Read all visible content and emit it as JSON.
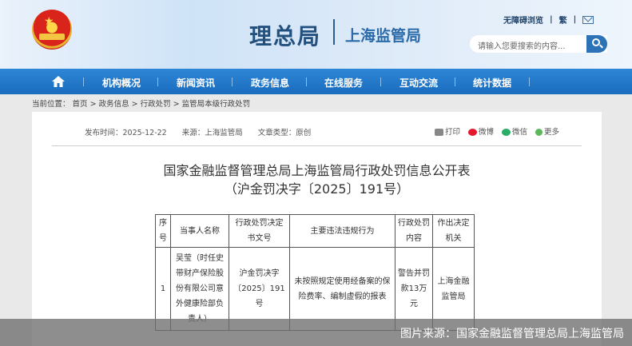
{
  "header": {
    "title": "理总局",
    "subtitle": "上海监管局",
    "accessibility": "无障碍浏览",
    "traditional": "繁",
    "search_placeholder": "请输入您要搜索的内容..."
  },
  "nav": {
    "items": [
      "机构概况",
      "新闻资讯",
      "政务信息",
      "在线服务",
      "互动交流",
      "统计数据"
    ]
  },
  "breadcrumb": {
    "prefix": "当前位置：",
    "items": [
      "首页",
      "政务信息",
      "行政处罚",
      "监管局本级行政处罚"
    ]
  },
  "article": {
    "publish_date": "发布时间：2025-12-22",
    "source": "来源：上海监管局",
    "doc_type": "文章类型：原创",
    "share": [
      "打印",
      "微博",
      "微信",
      "更多"
    ],
    "title_line1": "国家金融监督管理总局上海监管局行政处罚信息公开表",
    "title_line2": "（沪金罚决字〔2025〕191号）"
  },
  "table": {
    "headers": [
      "序号",
      "当事人名称",
      "行政处罚决定书文号",
      "主要违法违规行为",
      "行政处罚内容",
      "作出决定机关"
    ],
    "row": {
      "index": "1",
      "party": "吴莹（时任史带财产保险股份有限公司意外健康险部负责人）",
      "doc_number": "沪金罚决字〔2025〕191号",
      "violation": "未按照规定使用经备案的保险费率、编制虚假的报表",
      "penalty": "警告并罚款13万元",
      "authority": "上海金融监管局"
    }
  },
  "caption": "图片来源：国家金融监督管理总局上海监管局",
  "colors": {
    "nav": "#1f76c8",
    "title": "#22507f",
    "accent": "#2c72b6"
  }
}
